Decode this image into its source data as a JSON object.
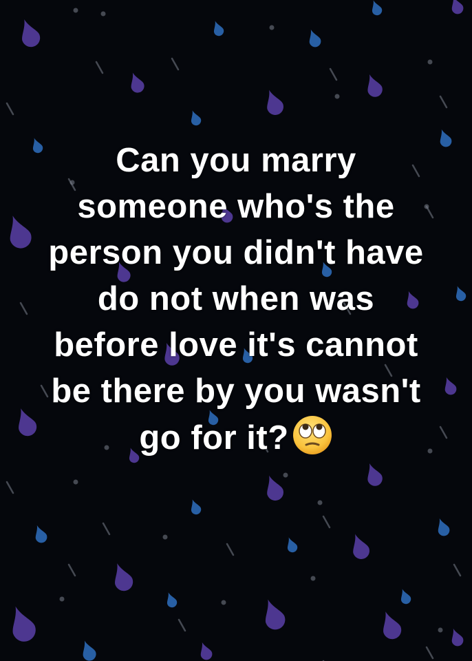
{
  "post": {
    "lines": [
      "Can you marry",
      "someone who's the",
      "person you didn't have",
      "do not when was",
      "before love it's cannot",
      "be there by you wasn't",
      "go for it?"
    ],
    "emoji": "face-with-rolling-eyes-emoji"
  },
  "colors": {
    "background": "#05070c",
    "text": "#ffffff",
    "drop_purple": "#5b3fa8",
    "drop_blue": "#2f6fbf",
    "streak": "#7a7f8c"
  }
}
